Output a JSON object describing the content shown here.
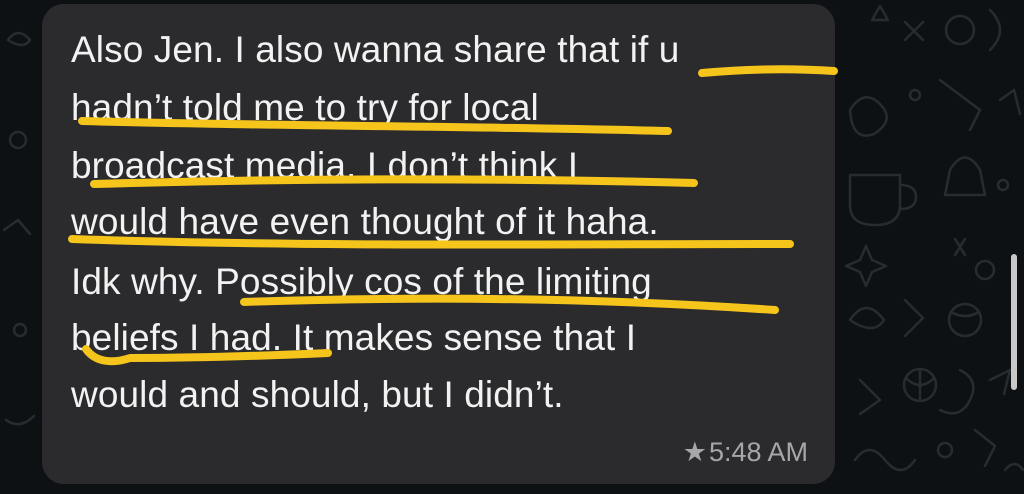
{
  "chat": {
    "message": {
      "lines": [
        "Also Jen. I also wanna share that if u",
        "hadn’t told me to try for local",
        "broadcast media, I don’t think I",
        "would have even thought of it haha.",
        "Idk why. Possibly cos of the limiting",
        "beliefs I had. It makes sense that I",
        "would and should, but I didn’t."
      ],
      "time": "5:48 AM",
      "starred_icon": "★"
    },
    "colors": {
      "bubble": "#2b2b2d",
      "text": "#f2f2f2",
      "highlight": "#f5c51c",
      "meta": "#a7a7a9",
      "wallpaper": "#0d1113"
    }
  }
}
